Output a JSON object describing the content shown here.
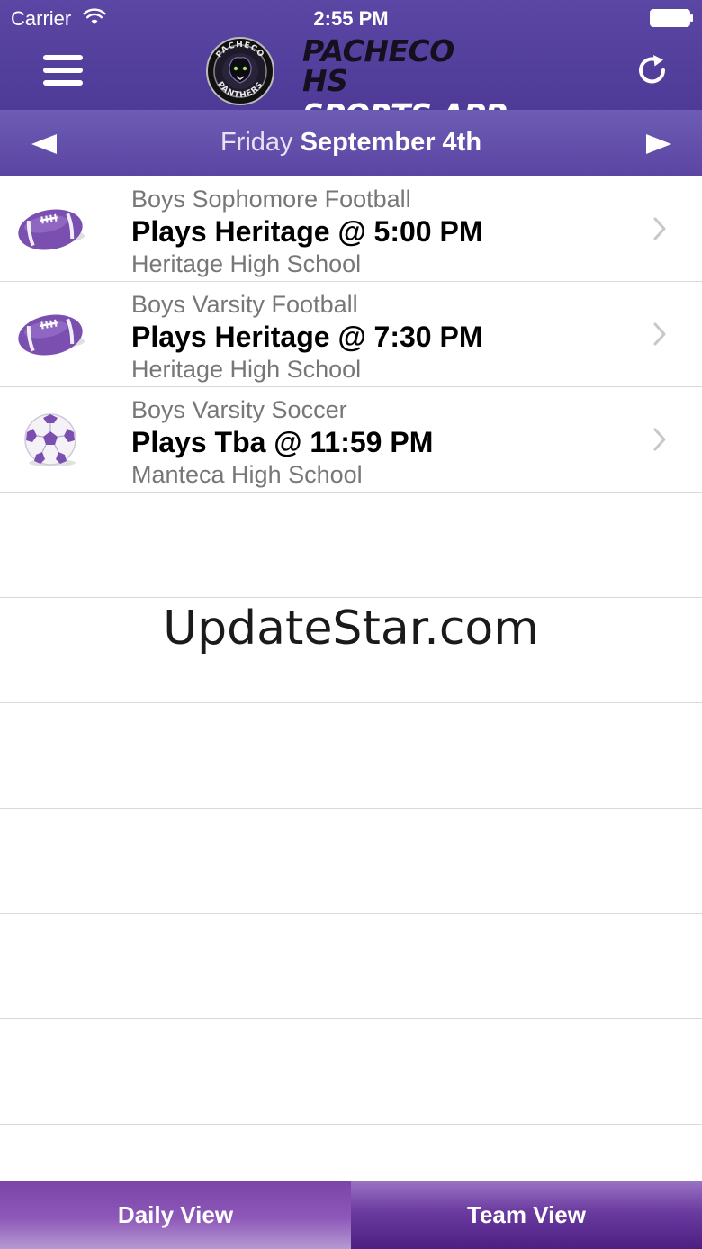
{
  "status_bar": {
    "carrier": "Carrier",
    "time": "2:55 PM"
  },
  "header": {
    "title_line1": "PACHECO HS",
    "title_line2": "SPORTS APP",
    "logo_text_top": "PACHECO",
    "logo_text_bottom": "PANTHERS"
  },
  "date_bar": {
    "weekday": "Friday",
    "date": "September 4th"
  },
  "games": [
    {
      "team": "Boys Sophomore Football",
      "matchup": "Plays Heritage @ 5:00 PM",
      "venue": "Heritage High School",
      "icon": "football-icon"
    },
    {
      "team": "Boys Varsity Football",
      "matchup": "Plays Heritage @ 7:30 PM",
      "venue": "Heritage High School",
      "icon": "football-icon"
    },
    {
      "team": "Boys Varsity Soccer",
      "matchup": "Plays Tba @ 11:59 PM",
      "venue": "Manteca High School",
      "icon": "soccer-ball-icon"
    }
  ],
  "watermark": "UpdateStar.com",
  "tabs": {
    "daily": "Daily View",
    "team": "Team View"
  },
  "colors": {
    "header": "#553f9e",
    "date_bar": "#6553ab",
    "accent_purple": "#7b4fb0"
  }
}
